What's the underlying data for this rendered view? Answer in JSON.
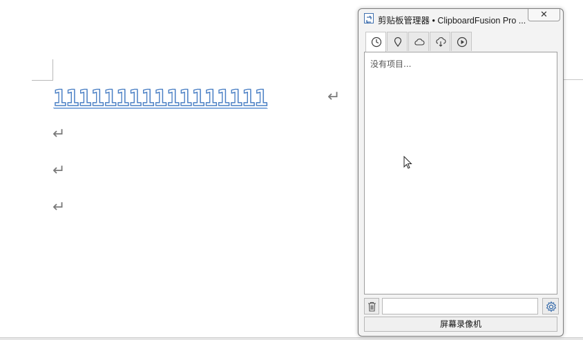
{
  "document": {
    "text_line": "11111111111111111",
    "paragraph_mark": "↵"
  },
  "window": {
    "title": "剪贴板管理器 • ClipboardFusion Pro ...",
    "close_label": "✕",
    "tabs": [
      {
        "icon": "clock-icon",
        "active": true
      },
      {
        "icon": "pin-icon",
        "active": false
      },
      {
        "icon": "cloud-icon",
        "active": false
      },
      {
        "icon": "cloud-download-icon",
        "active": false
      },
      {
        "icon": "play-icon",
        "active": false
      }
    ],
    "empty_text": "没有项目...",
    "search": {
      "value": "",
      "placeholder": ""
    },
    "footer_label": "屏幕录像机"
  },
  "colors": {
    "doc_text_outline": "#4a7fc4",
    "window_bg": "#f3f3f3"
  }
}
